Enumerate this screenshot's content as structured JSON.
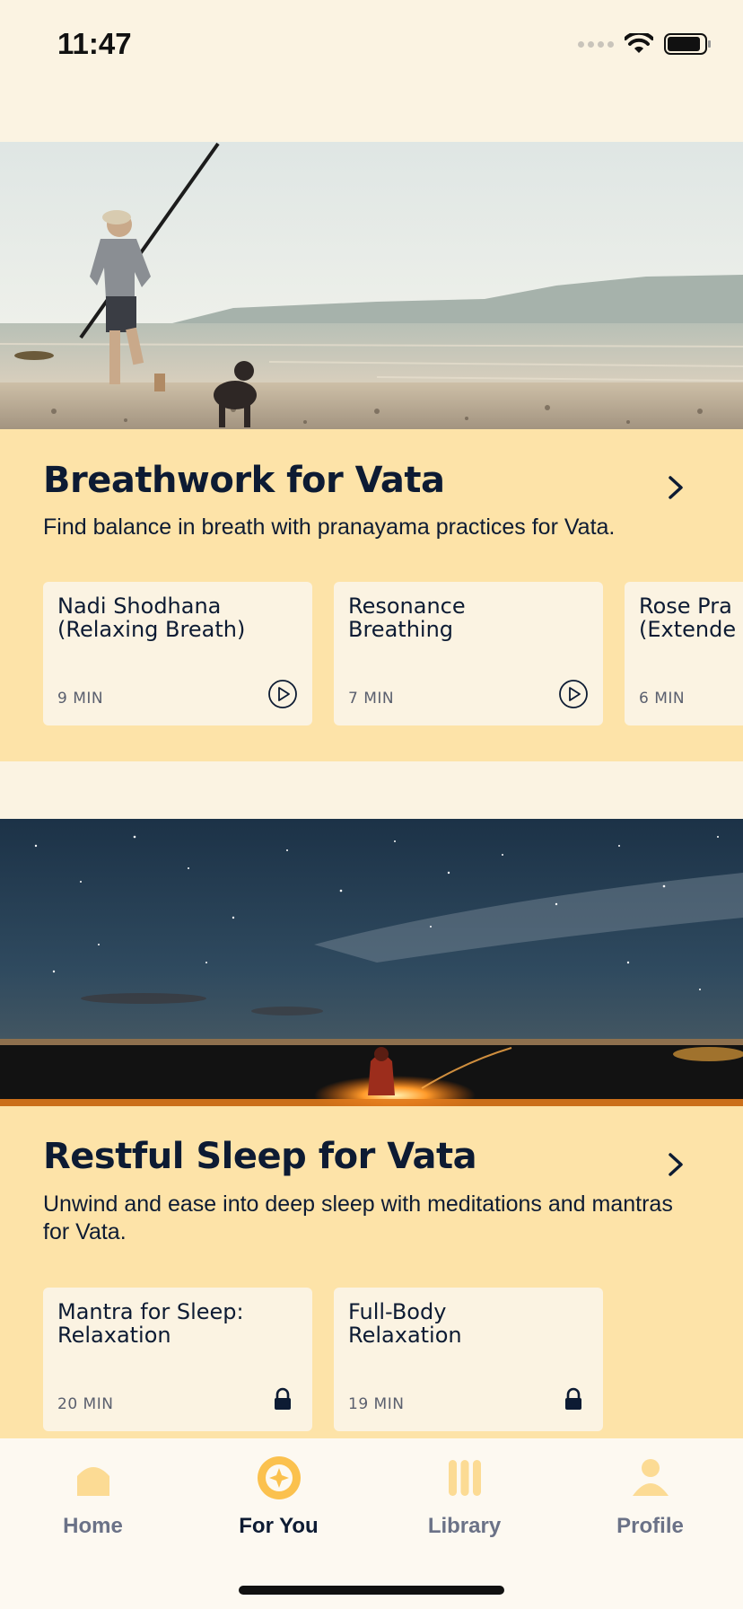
{
  "status_bar": {
    "time": "11:47"
  },
  "sections": [
    {
      "title": "Breathwork for Vata",
      "description": "Find balance in breath with pranayama practices for Vata.",
      "cards": [
        {
          "title": "Nadi Shodhana\n(Relaxing Breath)",
          "duration": "9 MIN",
          "icon": "play-icon"
        },
        {
          "title": "Resonance\nBreathing",
          "duration": "7 MIN",
          "icon": "play-icon"
        },
        {
          "title": "Rose Pra\n(Extende",
          "duration": "6 MIN",
          "icon": ""
        }
      ]
    },
    {
      "title": "Restful Sleep for Vata",
      "description": "Unwind and ease into deep sleep with meditations and mantras for Vata.",
      "cards": [
        {
          "title": "Mantra for Sleep:\nRelaxation",
          "duration": "20 MIN",
          "icon": "lock-icon"
        },
        {
          "title": "Full-Body\nRelaxation",
          "duration": "19 MIN",
          "icon": "lock-icon"
        }
      ]
    }
  ],
  "tab_bar": {
    "items": [
      {
        "label": "Home",
        "icon": "home-icon"
      },
      {
        "label": "For You",
        "icon": "compass-icon"
      },
      {
        "label": "Library",
        "icon": "library-icon"
      },
      {
        "label": "Profile",
        "icon": "profile-icon"
      }
    ],
    "active": "For You"
  },
  "colors": {
    "background": "#fbf3e2",
    "section": "#fde3a8",
    "card": "#fbf3e2",
    "text": "#0d1b33",
    "accent": "#fbc14e",
    "inactive_icon": "#fcdb94"
  }
}
